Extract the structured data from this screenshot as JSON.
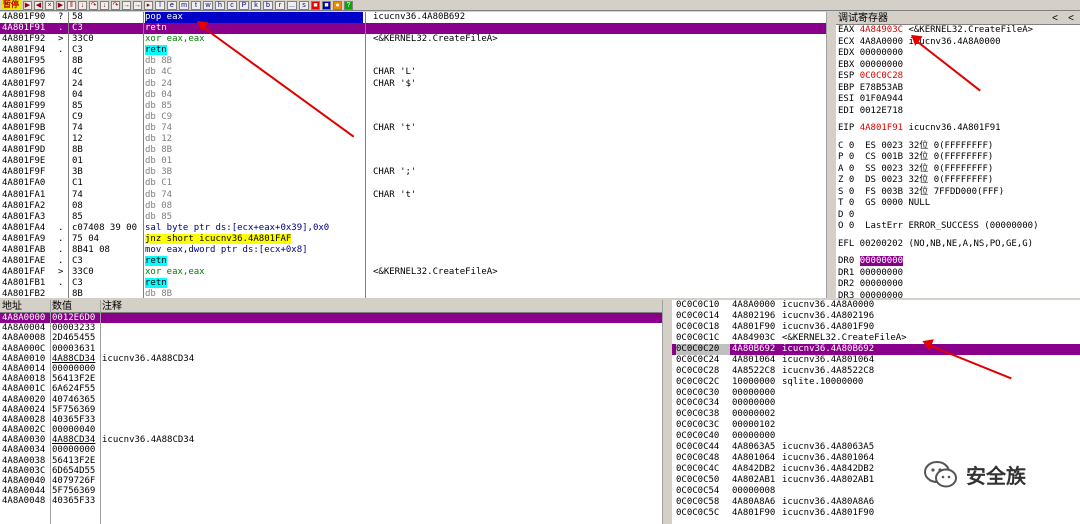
{
  "toolbar": {
    "status": "暂停",
    "letters": [
      "l",
      "e",
      "m",
      "t",
      "w",
      "h",
      "c",
      "P",
      "k",
      "b",
      "r",
      "...",
      "s"
    ]
  },
  "cpu": {
    "rows": [
      {
        "addr": "4A801F90",
        "mark": "?",
        "hex": "58",
        "dis": "pop eax",
        "cmt": "icucnv36.4A80B692",
        "first": true
      },
      {
        "addr": "4A801F91",
        "mark": ".",
        "hex": "C3",
        "dis": "retn",
        "cmt": "",
        "sel": true,
        "jc": true
      },
      {
        "addr": "4A801F92",
        "mark": ">",
        "hex": "33C0",
        "dis": "xor eax,eax",
        "cmt": "<&KERNEL32.CreateFileA>",
        "grn": true
      },
      {
        "addr": "4A801F94",
        "mark": ".",
        "hex": "C3",
        "dis": "retn",
        "cmt": "",
        "jc": true
      },
      {
        "addr": "4A801F95",
        "mark": "",
        "hex": "8B",
        "dis": "db 8B",
        "cmt": "",
        "gray": true
      },
      {
        "addr": "4A801F96",
        "mark": "",
        "hex": "4C",
        "dis": "db 4C",
        "cmt": "CHAR 'L'",
        "gray": true
      },
      {
        "addr": "4A801F97",
        "mark": "",
        "hex": "24",
        "dis": "db 24",
        "cmt": "CHAR '$'",
        "gray": true
      },
      {
        "addr": "4A801F98",
        "mark": "",
        "hex": "04",
        "dis": "db 04",
        "cmt": "",
        "gray": true
      },
      {
        "addr": "4A801F99",
        "mark": "",
        "hex": "85",
        "dis": "db 85",
        "cmt": "",
        "gray": true
      },
      {
        "addr": "4A801F9A",
        "mark": "",
        "hex": "C9",
        "dis": "db C9",
        "cmt": "",
        "gray": true
      },
      {
        "addr": "4A801F9B",
        "mark": "",
        "hex": "74",
        "dis": "db 74",
        "cmt": "CHAR 't'",
        "gray": true
      },
      {
        "addr": "4A801F9C",
        "mark": "",
        "hex": "12",
        "dis": "db 12",
        "cmt": "",
        "gray": true
      },
      {
        "addr": "4A801F9D",
        "mark": "",
        "hex": "8B",
        "dis": "db 8B",
        "cmt": "",
        "gray": true
      },
      {
        "addr": "4A801F9E",
        "mark": "",
        "hex": "01",
        "dis": "db 01",
        "cmt": "",
        "gray": true
      },
      {
        "addr": "4A801F9F",
        "mark": "",
        "hex": "3B",
        "dis": "db 3B",
        "cmt": "CHAR ';'",
        "gray": true
      },
      {
        "addr": "4A801FA0",
        "mark": "",
        "hex": "C1",
        "dis": "db C1",
        "cmt": "",
        "gray": true
      },
      {
        "addr": "4A801FA1",
        "mark": "",
        "hex": "74",
        "dis": "db 74",
        "cmt": "CHAR 't'",
        "gray": true
      },
      {
        "addr": "4A801FA2",
        "mark": "",
        "hex": "08",
        "dis": "db 08",
        "cmt": "",
        "gray": true
      },
      {
        "addr": "4A801FA3",
        "mark": "",
        "hex": "85",
        "dis": "db 85",
        "cmt": "",
        "gray": true
      },
      {
        "addr": "4A801FA4",
        "mark": ".",
        "hex": "c07408 39 00",
        "dis": "sal byte ptr ds:[ecx+eax+0x39],0x0",
        "cmt": "",
        "blu": true
      },
      {
        "addr": "4A801FA9",
        "mark": ".~",
        "hex": "75 04",
        "dis": "jnz short icucnv36.4A801FAF",
        "cmt": "",
        "jy": true
      },
      {
        "addr": "4A801FAB",
        "mark": ".",
        "hex": "8B41 08",
        "dis": "mov eax,dword ptr ds:[ecx+0x8]",
        "cmt": "",
        "blu": true
      },
      {
        "addr": "4A801FAE",
        "mark": ".",
        "hex": "C3",
        "dis": "retn",
        "cmt": "",
        "jc": true
      },
      {
        "addr": "4A801FAF",
        "mark": ">",
        "hex": "33C0",
        "dis": "xor eax,eax",
        "cmt": "<&KERNEL32.CreateFileA>",
        "grn": true
      },
      {
        "addr": "4A801FB1",
        "mark": ".",
        "hex": "C3",
        "dis": "retn",
        "cmt": "",
        "jc": true
      },
      {
        "addr": "4A801FB2",
        "mark": "",
        "hex": "8B",
        "dis": "db 8B",
        "cmt": "",
        "gray": true
      }
    ]
  },
  "regs": {
    "title": "调试寄存器",
    "lines": [
      {
        "k": "EAX",
        "v": "4A84903C",
        "c": "<&KERNEL32.CreateFileA>",
        "red": true
      },
      {
        "k": "ECX",
        "v": "4A8A0000",
        "c": "icucnv36.4A8A0000"
      },
      {
        "k": "EDX",
        "v": "00000000",
        "c": ""
      },
      {
        "k": "EBX",
        "v": "00000000",
        "c": ""
      },
      {
        "k": "ESP",
        "v": "0C0C0C28",
        "c": "",
        "red": true
      },
      {
        "k": "EBP",
        "v": "E78B53AB",
        "c": ""
      },
      {
        "k": "ESI",
        "v": "01F0A944",
        "c": ""
      },
      {
        "k": "EDI",
        "v": "0012E718",
        "c": ""
      },
      {
        "sp": true
      },
      {
        "k": "EIP",
        "v": "4A801F91",
        "c": "icucnv36.4A801F91",
        "red": true
      },
      {
        "sp": true
      },
      {
        "raw": "C 0  ES 0023 32位 0(FFFFFFFF)"
      },
      {
        "raw": "P 0  CS 001B 32位 0(FFFFFFFF)"
      },
      {
        "raw": "A 0  SS 0023 32位 0(FFFFFFFF)"
      },
      {
        "raw": "Z 0  DS 0023 32位 0(FFFFFFFF)"
      },
      {
        "raw": "S 0  FS 003B 32位 7FFDD000(FFF)"
      },
      {
        "raw": "T 0  GS 0000 NULL"
      },
      {
        "raw": "D 0"
      },
      {
        "raw": "O 0  LastErr ERROR_SUCCESS (00000000)"
      },
      {
        "sp": true
      },
      {
        "raw": "EFL 00200202 (NO,NB,NE,A,NS,PO,GE,G)"
      },
      {
        "sp": true
      },
      {
        "k": "DR0",
        "v": "00000000",
        "c": "",
        "mag": true
      },
      {
        "k": "DR1",
        "v": "00000000",
        "c": ""
      },
      {
        "k": "DR2",
        "v": "00000000",
        "c": ""
      },
      {
        "k": "DR3",
        "v": "00000000",
        "c": ""
      }
    ]
  },
  "dump": {
    "headers": {
      "addr": "地址",
      "val": "数值",
      "cmt": "注释"
    },
    "rows": [
      {
        "a": "4A8A0000",
        "v": "0012E6D0",
        "c": "",
        "sel": true
      },
      {
        "a": "4A8A0004",
        "v": "00003233",
        "c": ""
      },
      {
        "a": "4A8A0008",
        "v": "2D465455",
        "c": ""
      },
      {
        "a": "4A8A000C",
        "v": "00003631",
        "c": ""
      },
      {
        "a": "4A8A0010",
        "v": "4A88CD34",
        "c": "icucnv36.4A88CD34",
        "ul": true
      },
      {
        "a": "4A8A0014",
        "v": "00000000",
        "c": ""
      },
      {
        "a": "4A8A0018",
        "v": "56413F2E",
        "c": ""
      },
      {
        "a": "4A8A001C",
        "v": "6A624F55",
        "c": ""
      },
      {
        "a": "4A8A0020",
        "v": "40746365",
        "c": ""
      },
      {
        "a": "4A8A0024",
        "v": "5F756369",
        "c": ""
      },
      {
        "a": "4A8A0028",
        "v": "40365F33",
        "c": ""
      },
      {
        "a": "4A8A002C",
        "v": "00000040",
        "c": ""
      },
      {
        "a": "4A8A0030",
        "v": "4A88CD34",
        "c": "icucnv36.4A88CD34",
        "ul": true
      },
      {
        "a": "4A8A0034",
        "v": "00000000",
        "c": ""
      },
      {
        "a": "4A8A0038",
        "v": "56413F2E",
        "c": ""
      },
      {
        "a": "4A8A003C",
        "v": "6D654D55",
        "c": ""
      },
      {
        "a": "4A8A0040",
        "v": "4079726F",
        "c": ""
      },
      {
        "a": "4A8A0044",
        "v": "5F756369",
        "c": ""
      },
      {
        "a": "4A8A0048",
        "v": "40365F33",
        "c": ""
      }
    ]
  },
  "stack": {
    "rows": [
      {
        "a": "0C0C0C10",
        "v": "4A8A0000",
        "c": "icucnv36.4A8A0000"
      },
      {
        "a": "0C0C0C14",
        "v": "4A802196",
        "c": "icucnv36.4A802196"
      },
      {
        "a": "0C0C0C18",
        "v": "4A801F90",
        "c": "icucnv36.4A801F90"
      },
      {
        "a": "0C0C0C1C",
        "v": "4A84903C",
        "c": "<&KERNEL32.CreateFileA>"
      },
      {
        "a": "0C0C0C20",
        "v": "4A80B692",
        "c": "icucnv36.4A80B692",
        "sel": true
      },
      {
        "a": "0C0C0C24",
        "v": "4A801064",
        "c": "icucnv36.4A801064"
      },
      {
        "a": "0C0C0C28",
        "v": "4A8522C8",
        "c": "icucnv36.4A8522C8"
      },
      {
        "a": "0C0C0C2C",
        "v": "10000000",
        "c": "sqlite.10000000"
      },
      {
        "a": "0C0C0C30",
        "v": "00000000",
        "c": ""
      },
      {
        "a": "0C0C0C34",
        "v": "00000000",
        "c": ""
      },
      {
        "a": "0C0C0C38",
        "v": "00000002",
        "c": ""
      },
      {
        "a": "0C0C0C3C",
        "v": "00000102",
        "c": ""
      },
      {
        "a": "0C0C0C40",
        "v": "00000000",
        "c": ""
      },
      {
        "a": "0C0C0C44",
        "v": "4A8063A5",
        "c": "icucnv36.4A8063A5"
      },
      {
        "a": "0C0C0C48",
        "v": "4A801064",
        "c": "icucnv36.4A801064"
      },
      {
        "a": "0C0C0C4C",
        "v": "4A842DB2",
        "c": "icucnv36.4A842DB2"
      },
      {
        "a": "0C0C0C50",
        "v": "4A802AB1",
        "c": "icucnv36.4A802AB1"
      },
      {
        "a": "0C0C0C54",
        "v": "00000008",
        "c": ""
      },
      {
        "a": "0C0C0C58",
        "v": "4A80A8A6",
        "c": "icucnv36.4A80A8A6"
      },
      {
        "a": "0C0C0C5C",
        "v": "4A801F90",
        "c": "icucnv36.4A801F90"
      }
    ]
  },
  "watermark": "安全族"
}
